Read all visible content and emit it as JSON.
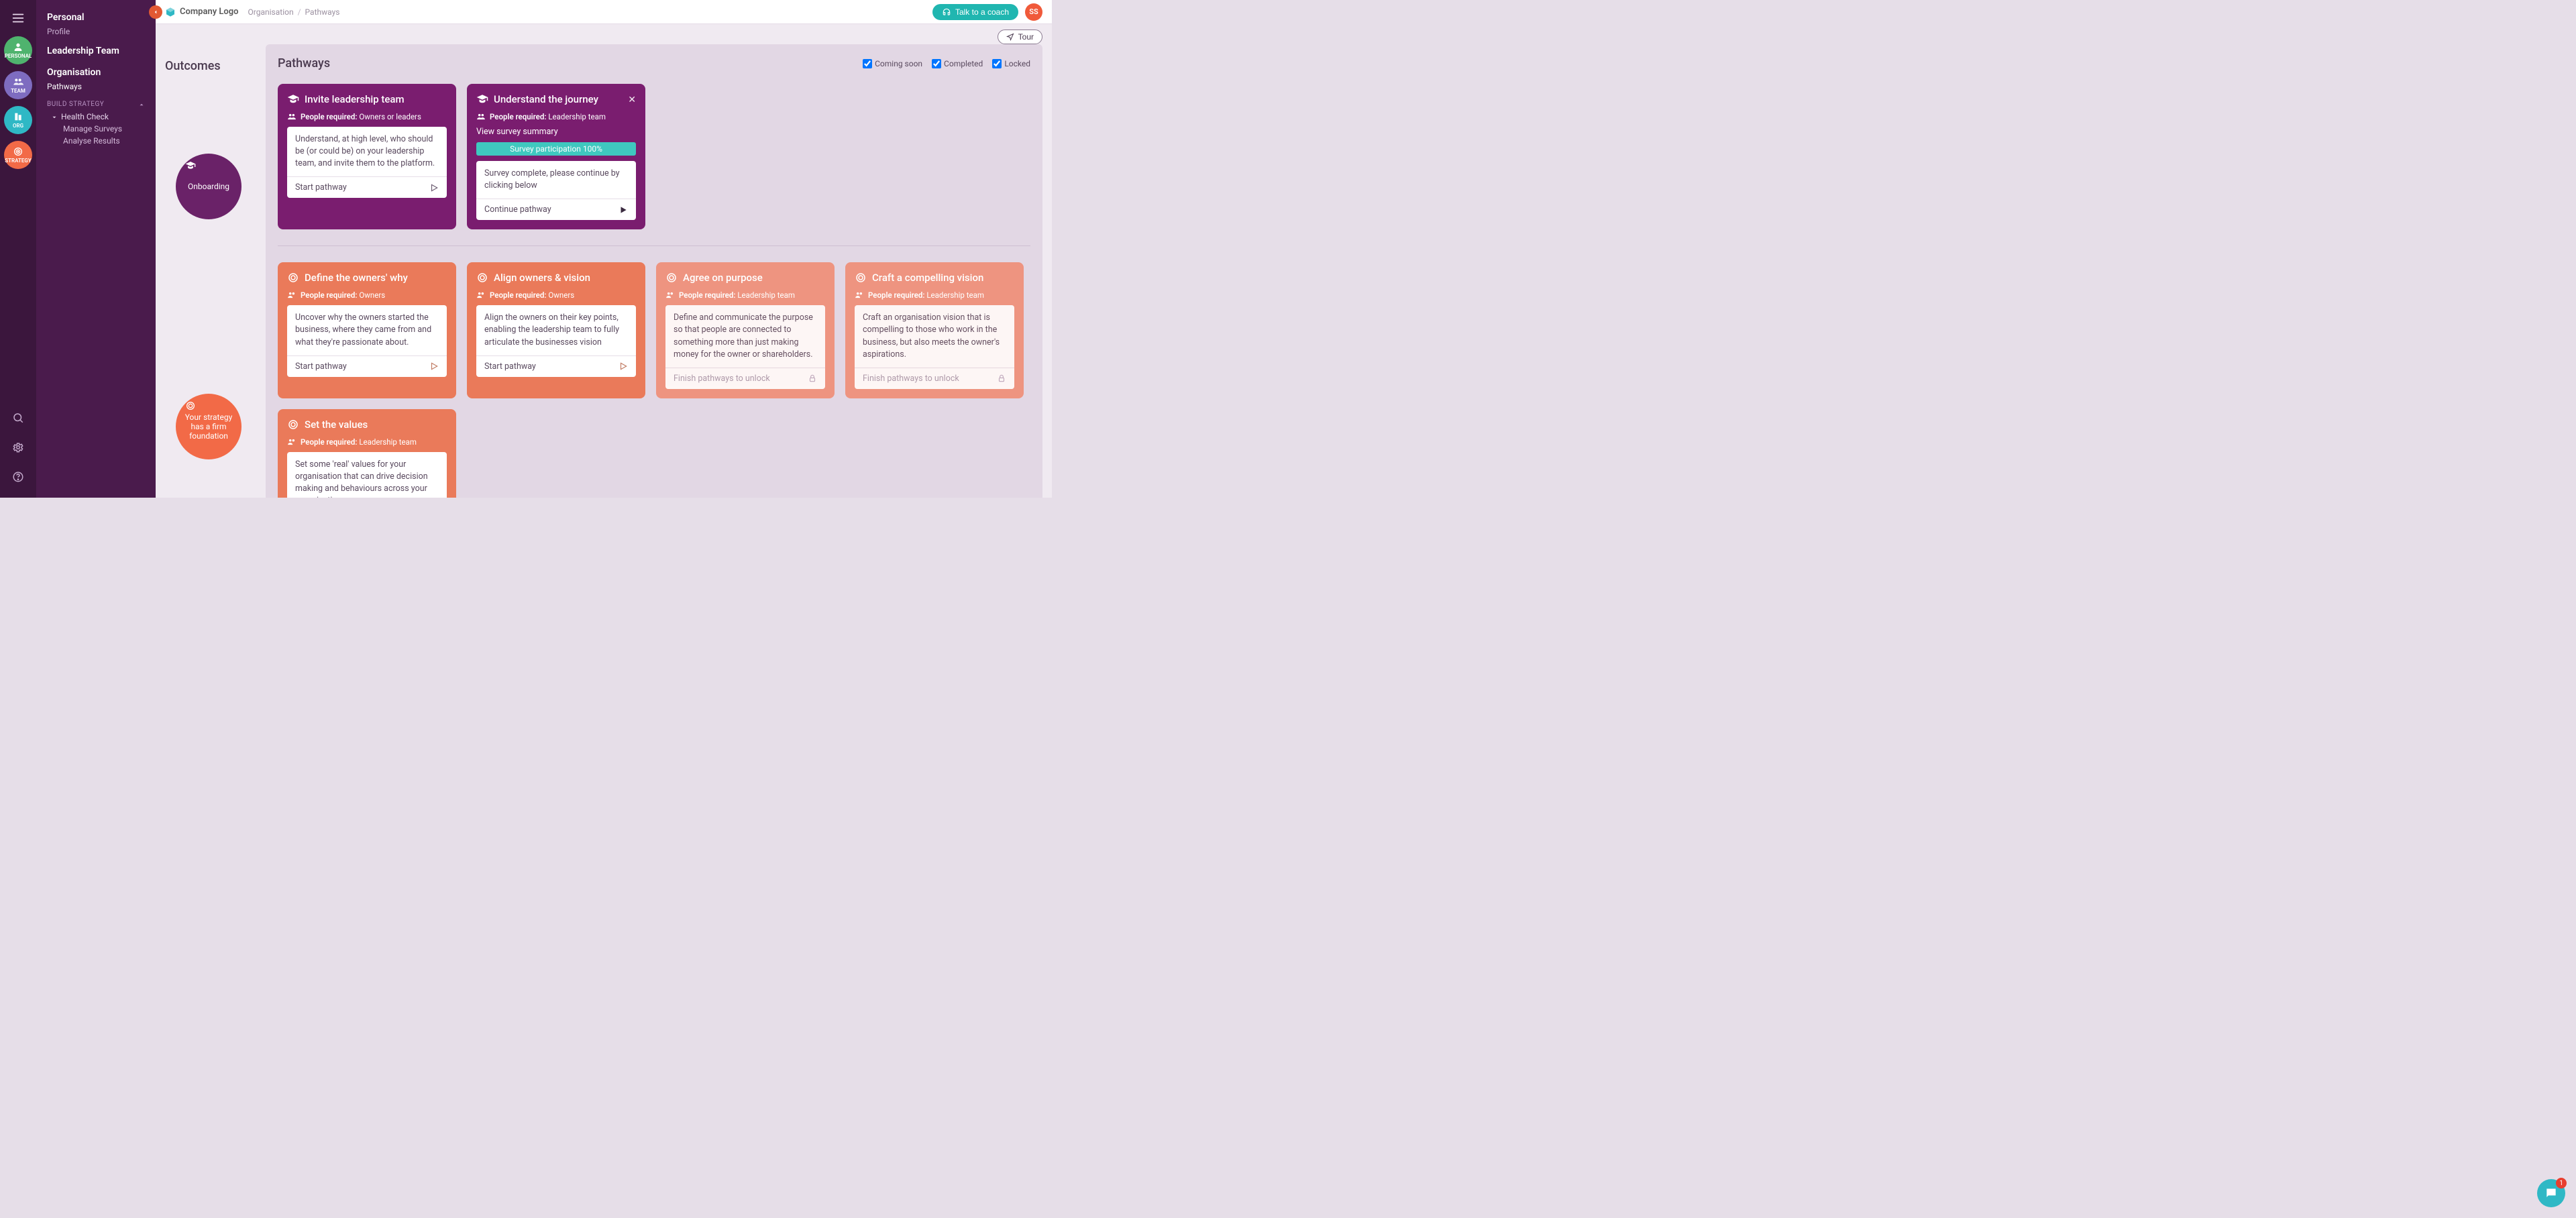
{
  "rail": {
    "personal": "PERSONAL",
    "team": "TEAM",
    "org": "ORG",
    "strategy": "STRATEGY"
  },
  "sidebar": {
    "personal": {
      "title": "Personal",
      "profile": "Profile"
    },
    "leadership": {
      "title": "Leadership Team"
    },
    "organisation": {
      "title": "Organisation",
      "pathways": "Pathways",
      "buildStrategy": "BUILD STRATEGY",
      "healthCheck": "Health Check",
      "manageSurveys": "Manage Surveys",
      "analyseResults": "Analyse Results"
    }
  },
  "topbar": {
    "logo": "Company Logo",
    "crumb1": "Organisation",
    "crumb2": "Pathways",
    "coach": "Talk to a coach",
    "avatar": "SS",
    "tour": "Tour"
  },
  "outcomes": {
    "heading": "Outcomes",
    "onboarding": "Onboarding",
    "foundation": "Your strategy has a firm foundation"
  },
  "pathways": {
    "heading": "Pathways",
    "filters": {
      "comingSoon": "Coming soon",
      "completed": "Completed",
      "locked": "Locked"
    }
  },
  "labels": {
    "peopleRequired": "People required:",
    "startPathway": "Start pathway",
    "continuePathway": "Continue pathway",
    "finishToUnlock": "Finish pathways to unlock"
  },
  "cards": {
    "invite": {
      "title": "Invite leadership team",
      "people": "Owners or leaders",
      "desc": "Understand, at high level, who should be (or could be) on your leadership team, and invite them to the platform."
    },
    "journey": {
      "title": "Understand the journey",
      "people": "Leadership team",
      "surveyLink": "View survey summary",
      "progress": "Survey participation 100%",
      "desc": "Survey complete, please continue by clicking below"
    },
    "ownersWhy": {
      "title": "Define the owners' why",
      "people": "Owners",
      "desc": "Uncover why the owners started the business, where they came from and what they're passionate about."
    },
    "alignVision": {
      "title": "Align owners & vision",
      "people": "Owners",
      "desc": "Align the owners on their key points, enabling the leadership team to fully articulate the businesses vision"
    },
    "agreePurpose": {
      "title": "Agree on purpose",
      "people": "Leadership team",
      "desc": "Define and communicate the purpose so that people are connected to something more than just making money for the owner or shareholders."
    },
    "craftVision": {
      "title": "Craft a compelling vision",
      "people": "Leadership team",
      "desc": "Craft an organisation vision that is compelling to those who work in the business, but also meets the owner's aspirations."
    },
    "setValues": {
      "title": "Set the values",
      "people": "Leadership team",
      "desc": "Set some 'real' values for your organisation that can drive decision making and behaviours across your organisation."
    }
  },
  "chat": {
    "badge": "1"
  }
}
